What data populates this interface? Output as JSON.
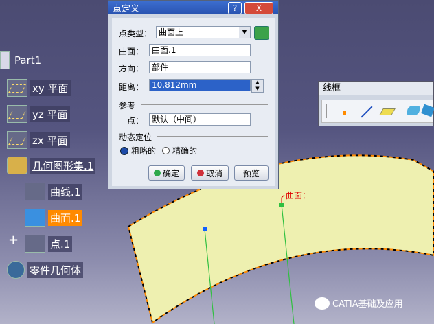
{
  "tree": {
    "root": "Part1",
    "items": [
      {
        "label": "xy 平面",
        "icon": "plane-icon"
      },
      {
        "label": "yz 平面",
        "icon": "plane-icon"
      },
      {
        "label": "zx 平面",
        "icon": "plane-icon"
      },
      {
        "label": "几何图形集.1",
        "icon": "geometrical-set-icon"
      },
      {
        "label": "曲线.1",
        "icon": "curve-icon"
      },
      {
        "label": "曲面.1",
        "icon": "surface-icon"
      },
      {
        "label": "点.1",
        "icon": "point-icon"
      },
      {
        "label": "零件几何体",
        "icon": "part-body-icon"
      }
    ],
    "expand_symbol": "+"
  },
  "dialog": {
    "title": "点定义",
    "help_btn": "?",
    "close_btn": "X",
    "point_type_label": "点类型：",
    "point_type_value": "曲面上",
    "surface_label": "曲面：",
    "surface_value": "曲面.1",
    "direction_label": "方向：",
    "direction_value": "部件",
    "distance_label": "距离：",
    "distance_value": "10.812mm",
    "reference_title": "参考",
    "point_label": "点：",
    "point_value": "默认（中间）",
    "dynamic_title": "动态定位",
    "radio_coarse": "粗略的",
    "radio_fine": "精确的",
    "ok": "确定",
    "cancel": "取消",
    "preview": "预览"
  },
  "viewport": {
    "surface_label": "曲面："
  },
  "toolbar": {
    "title": "线框"
  },
  "watermark": {
    "text": "CATIA基础及应用"
  },
  "colors": {
    "selected": "#ff8a00",
    "surface_fill": "#eef0b0",
    "label_red": "#e00000"
  }
}
